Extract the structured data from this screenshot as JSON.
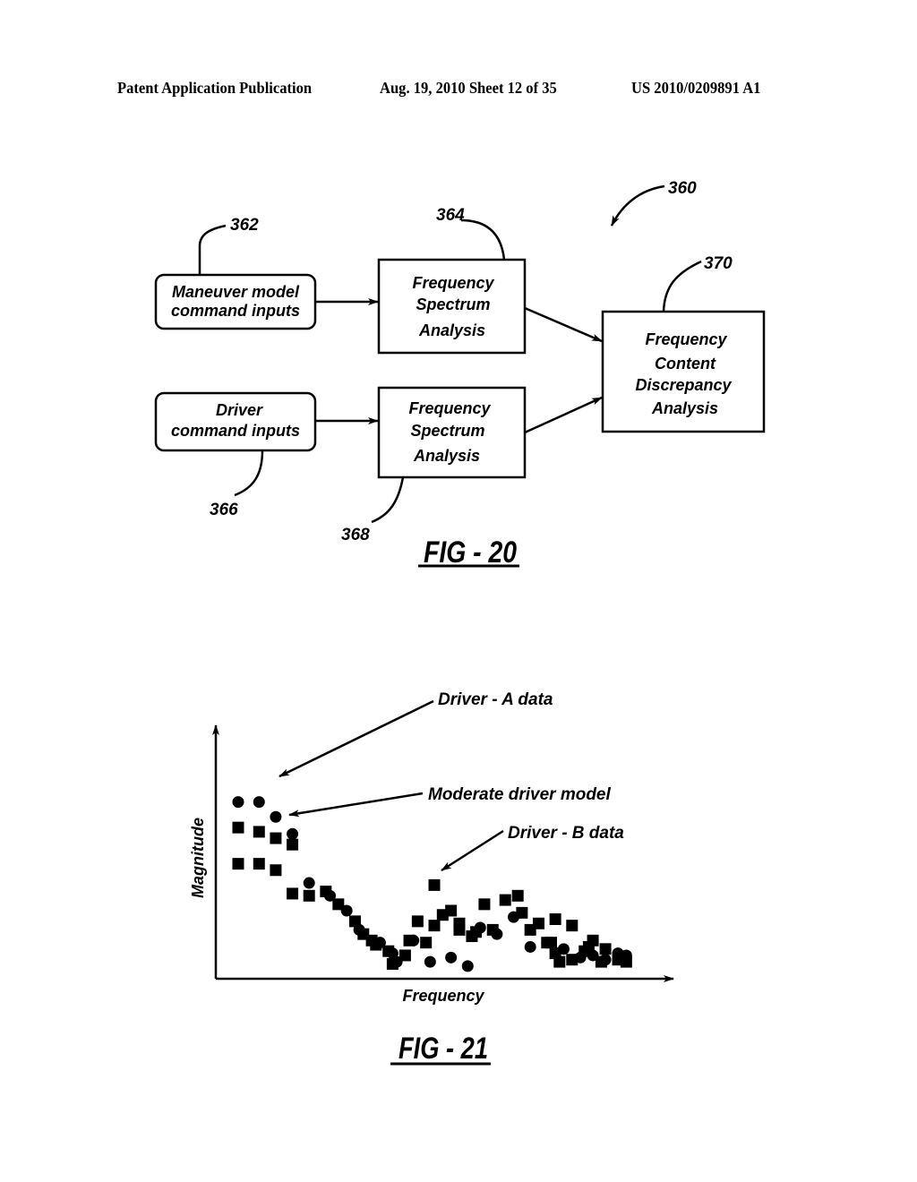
{
  "header": {
    "publication": "Patent Application Publication",
    "date_sheet": "Aug. 19, 2010  Sheet 12 of 35",
    "number": "US 2010/0209891 A1"
  },
  "fig20": {
    "caption": "FIG - 20",
    "system_ref": "360",
    "blocks": {
      "maneuver": {
        "lines": [
          "Maneuver model",
          "command inputs"
        ],
        "ref": "362"
      },
      "driver": {
        "lines": [
          "Driver",
          "command inputs"
        ],
        "ref": "366"
      },
      "fsa_top": {
        "lines": [
          "Frequency",
          "Spectrum",
          "Analysis"
        ],
        "ref": "364"
      },
      "fsa_bottom": {
        "lines": [
          "Frequency",
          "Spectrum",
          "Analysis"
        ],
        "ref": "368"
      },
      "discrepancy": {
        "lines": [
          "Frequency",
          "Content",
          "Discrepancy",
          "Analysis"
        ],
        "ref": "370"
      }
    }
  },
  "chart_data": {
    "type": "scatter",
    "title": "FIG - 21",
    "xlabel": "Frequency",
    "ylabel": "Magnitude",
    "xlim": [
      0,
      100
    ],
    "ylim": [
      0,
      100
    ],
    "grid": false,
    "axis_ticks": "none",
    "annotations": [
      {
        "text": "Driver - A data",
        "points_to": "circle series"
      },
      {
        "text": "Moderate driver model",
        "points_to": "square series (upper)"
      },
      {
        "text": "Driver - B data",
        "points_to": "square series (lower/right)"
      }
    ],
    "series": [
      {
        "name": "Driver - A data",
        "marker": "circle",
        "points": [
          [
            3,
            80
          ],
          [
            8,
            80
          ],
          [
            12,
            73
          ],
          [
            16,
            65
          ],
          [
            20,
            42
          ],
          [
            25,
            36
          ],
          [
            29,
            29
          ],
          [
            32,
            20
          ],
          [
            37,
            14
          ],
          [
            40,
            9
          ],
          [
            41,
            5
          ],
          [
            45,
            15
          ],
          [
            49,
            5
          ],
          [
            54,
            7
          ],
          [
            58,
            3
          ],
          [
            61,
            21
          ],
          [
            65,
            18
          ],
          [
            69,
            26
          ],
          [
            73,
            12
          ],
          [
            77,
            14
          ],
          [
            81,
            11
          ],
          [
            85,
            7
          ],
          [
            88,
            8
          ],
          [
            91,
            6
          ],
          [
            94,
            9
          ],
          [
            96,
            8
          ]
        ]
      },
      {
        "name": "Moderate driver model",
        "marker": "square",
        "points": [
          [
            3,
            68
          ],
          [
            8,
            66
          ],
          [
            12,
            63
          ],
          [
            16,
            60
          ],
          [
            3,
            51
          ],
          [
            8,
            51
          ],
          [
            12,
            48
          ],
          [
            16,
            37
          ],
          [
            20,
            36
          ],
          [
            24,
            38
          ],
          [
            27,
            32
          ],
          [
            31,
            24
          ],
          [
            33,
            18
          ],
          [
            35,
            15
          ],
          [
            36,
            13
          ],
          [
            39,
            10
          ],
          [
            40,
            4
          ],
          [
            43,
            8
          ],
          [
            46,
            24
          ],
          [
            50,
            22
          ],
          [
            54,
            29
          ],
          [
            56,
            23
          ],
          [
            59,
            17
          ],
          [
            62,
            32
          ],
          [
            67,
            34
          ],
          [
            71,
            28
          ],
          [
            75,
            23
          ],
          [
            77,
            14
          ],
          [
            79,
            25
          ],
          [
            83,
            22
          ],
          [
            86,
            10
          ],
          [
            88,
            15
          ]
        ]
      },
      {
        "name": "Driver - B data",
        "marker": "square",
        "points": [
          [
            50,
            41
          ],
          [
            44,
            15
          ],
          [
            48,
            14
          ],
          [
            52,
            27
          ],
          [
            56,
            20
          ],
          [
            60,
            19
          ],
          [
            64,
            20
          ],
          [
            70,
            36
          ],
          [
            73,
            20
          ],
          [
            78,
            14
          ],
          [
            79,
            9
          ],
          [
            80,
            5
          ],
          [
            83,
            6
          ],
          [
            87,
            12
          ],
          [
            90,
            5
          ],
          [
            91,
            11
          ],
          [
            94,
            6
          ],
          [
            96,
            5
          ]
        ]
      }
    ]
  }
}
